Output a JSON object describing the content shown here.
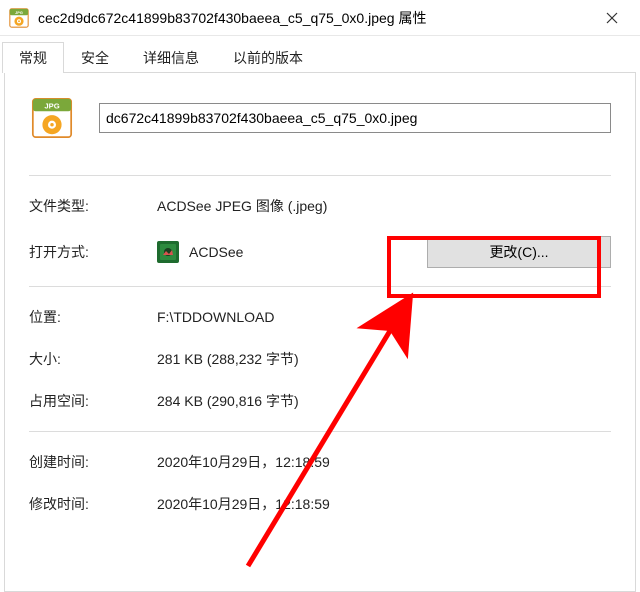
{
  "titlebar": {
    "title": "cec2d9dc672c41899b83702f430baeea_c5_q75_0x0.jpeg 属性"
  },
  "tabs": {
    "general": "常规",
    "security": "安全",
    "details": "详细信息",
    "previous": "以前的版本"
  },
  "filename": {
    "value": "dc672c41899b83702f430baeea_c5_q75_0x0.jpeg"
  },
  "labels": {
    "filetype": "文件类型:",
    "openwith": "打开方式:",
    "location": "位置:",
    "size": "大小:",
    "sizeondisk": "占用空间:",
    "created": "创建时间:",
    "modified": "修改时间:"
  },
  "values": {
    "filetype": "ACDSee JPEG 图像 (.jpeg)",
    "openwith": "ACDSee",
    "location": "F:\\TDDOWNLOAD",
    "size": "281 KB (288,232 字节)",
    "sizeondisk": "284 KB (290,816 字节)",
    "created": "2020年10月29日，12:18:59",
    "modified": "2020年10月29日，12:18:59"
  },
  "buttons": {
    "change": "更改(C)..."
  }
}
